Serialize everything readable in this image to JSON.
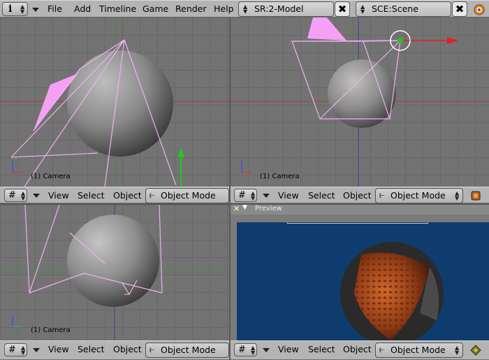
{
  "topbar": {
    "menus": [
      "File",
      "Add",
      "Timeline",
      "Game",
      "Render",
      "Help"
    ],
    "screen_field": "SR:2-Model",
    "scene_field": "SCE:Scene",
    "close_glyph": "✖"
  },
  "viewports": [
    {
      "camera_label": "(1) Camera",
      "menus": [
        "View",
        "Select",
        "Object"
      ],
      "mode": "Object Mode"
    },
    {
      "camera_label": "(1) Camera",
      "menus": [
        "View",
        "Select",
        "Object"
      ],
      "mode": "Object Mode"
    },
    {
      "camera_label": "(1) Camera",
      "menus": [
        "View",
        "Select",
        "Object"
      ],
      "mode": "Object Mode"
    }
  ],
  "preview": {
    "title": "Preview",
    "menus": [
      "View",
      "Select",
      "Object"
    ],
    "mode": "Object Mode"
  },
  "colors": {
    "grid_bg": "#737373",
    "x_axis": "#a03c3c",
    "z_axis": "#3c3ca0",
    "y_axis": "#3c8c3c",
    "camera_wire": "#f0b0f0",
    "preview_bg": "#0e3c6e"
  }
}
